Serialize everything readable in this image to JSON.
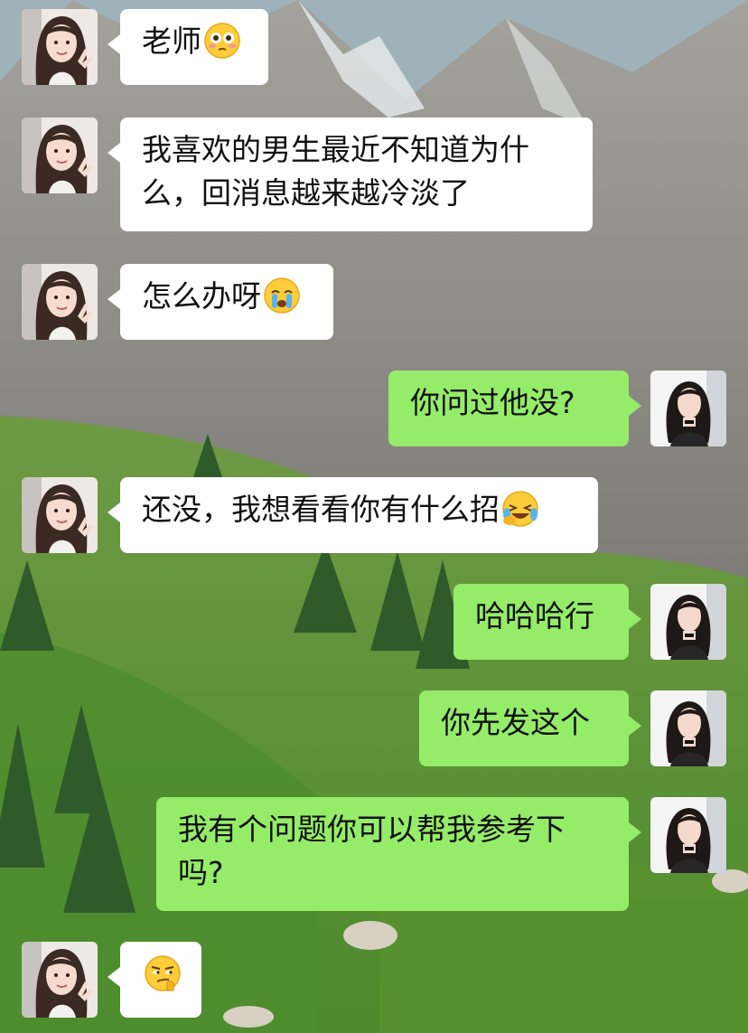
{
  "conversation": {
    "messages": [
      {
        "side": "incoming",
        "text": "老师",
        "emoji": "flushed-face"
      },
      {
        "side": "incoming",
        "text": "我喜欢的男生最近不知道为什么，回消息越来越冷淡了"
      },
      {
        "side": "incoming",
        "text": "怎么办呀",
        "emoji": "crying-face"
      },
      {
        "side": "outgoing",
        "text": "你问过他没?"
      },
      {
        "side": "incoming",
        "text": "还没，我想看看你有什么招",
        "emoji": "laughing-tears-face"
      },
      {
        "side": "outgoing",
        "text": "哈哈哈行"
      },
      {
        "side": "outgoing",
        "text": "你先发这个"
      },
      {
        "side": "outgoing",
        "text": "我有个问题你可以帮我参考下吗?"
      },
      {
        "side": "incoming",
        "text": "",
        "emoji": "smirk-face"
      }
    ]
  },
  "colors": {
    "incoming_bubble": "#ffffff",
    "outgoing_bubble": "#95ec69",
    "text": "#111111"
  }
}
